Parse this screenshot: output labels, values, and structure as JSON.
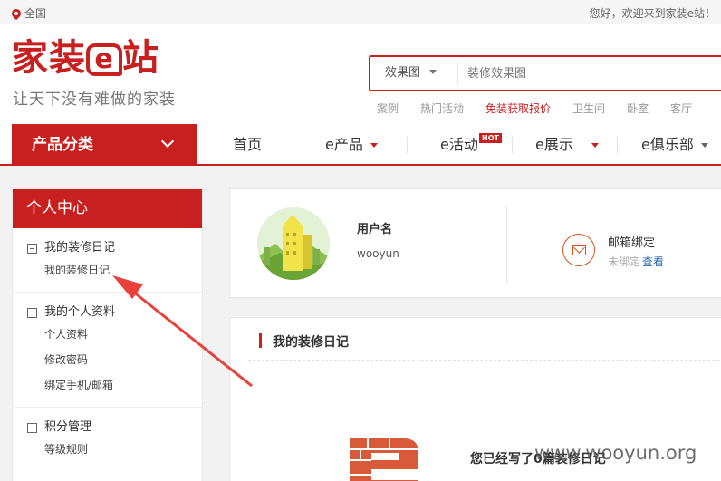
{
  "topbar": {
    "location": "全国",
    "welcome": "您好，欢迎来到家装e站！"
  },
  "header": {
    "logo": "家装e站",
    "slogan": "让天下没有难做的家装",
    "search": {
      "type_select": "效果图",
      "placeholder": "装修效果图"
    },
    "hot_links": [
      "案例",
      "热门活动",
      "免装获取报价",
      "卫生间",
      "卧室",
      "客厅"
    ]
  },
  "nav": {
    "category_button": "产品分类",
    "items": [
      "首页",
      "e产品",
      "e活动",
      "e展示",
      "e俱乐部"
    ],
    "hot_badge": "HOT"
  },
  "sidebar": {
    "title": "个人中心",
    "groups": [
      {
        "title": "我的装修日记",
        "items": [
          "我的装修日记"
        ]
      },
      {
        "title": "我的个人资料",
        "items": [
          "个人资料",
          "修改密码",
          "绑定手机/邮箱"
        ]
      },
      {
        "title": "积分管理",
        "items": [
          "等级规则"
        ]
      }
    ]
  },
  "profile": {
    "username_label": "用户名",
    "username": "wooyun",
    "email_title": "邮箱绑定",
    "email_status": "未绑定",
    "email_action": "查看"
  },
  "diary": {
    "title": "我的装修日记",
    "empty_text": "您已经写了0篇装修日记"
  },
  "watermark": "www.wooyun.org",
  "colors": {
    "brand": "#c8201f",
    "accent_orange": "#d9531e",
    "link": "#2b6cb0"
  }
}
